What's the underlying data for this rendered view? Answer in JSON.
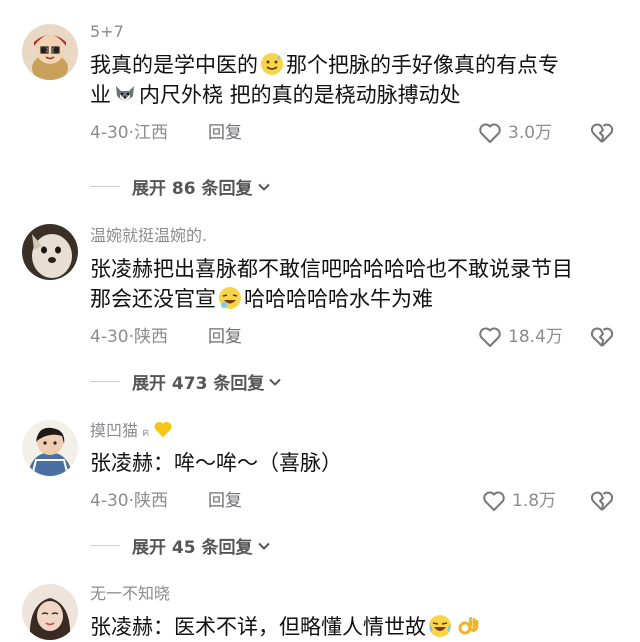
{
  "comments": [
    {
      "username": "5+7",
      "text_a": "我真的是学中医的",
      "text_b": "那个把脉的手好像真的有点专",
      "text_c": "业",
      "text_d": "内尺外桡 把的真的是桡动脉搏动处",
      "date": "4-30·江西",
      "reply": "回复",
      "likes": "3.0万",
      "expand": "展开 86 条回复"
    },
    {
      "username": "温婉就挺温婉的.",
      "text_a": "张凌赫把出喜脉都不敢信吧哈哈哈哈也不敢说录节目",
      "text_b": "那会还没官宣",
      "text_c": "哈哈哈哈哈水牛为难",
      "date": "4-30·陕西",
      "reply": "回复",
      "likes": "18.4万",
      "expand": "展开 473 条回复"
    },
    {
      "username": "摸凹猫",
      "badge_letter": "ฅ",
      "text_a": "张凌赫：哞～哞～（喜脉）",
      "date": "4-30·陕西",
      "reply": "回复",
      "likes": "1.8万",
      "expand": "展开 45 条回复"
    },
    {
      "username": "无一不知晓",
      "text_a": "张凌赫：医术不详，但略懂人情世故"
    }
  ],
  "icons": {
    "like": "heart-outline-icon",
    "dislike": "broken-heart-icon",
    "expand": "chevron-down-icon"
  },
  "colors": {
    "muted_text": "#8b8b90",
    "body_text": "#111111",
    "badge_heart": "#f5c518"
  }
}
